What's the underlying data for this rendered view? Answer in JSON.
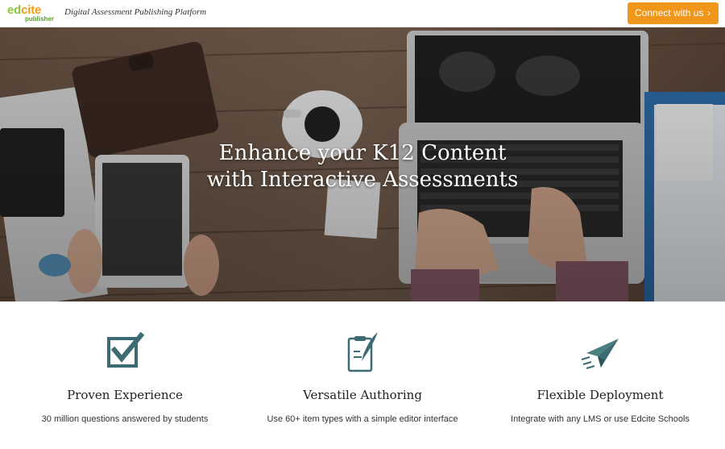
{
  "header": {
    "logo_main_ed": "ed",
    "logo_main_cite": "cite",
    "logo_sub": "publisher",
    "tagline": "Digital Assessment Publishing Platform",
    "connect_label": "Connect with us",
    "connect_icon": "chevron-right-icon"
  },
  "hero": {
    "title_line1": "Enhance your K12 Content",
    "title_line2": "with Interactive Assessments"
  },
  "features": [
    {
      "title": "Proven Experience",
      "description": "30 million questions answered by students",
      "icon": "checkbox-icon"
    },
    {
      "title": "Versatile Authoring",
      "description": "Use 60+ item types with a simple editor interface",
      "icon": "clipboard-quill-icon"
    },
    {
      "title": "Flexible Deployment",
      "description": "Integrate with any LMS or use Edcite Schools",
      "icon": "paper-plane-icon"
    }
  ],
  "colors": {
    "accent_orange": "#f0961b",
    "icon_teal": "#3d6b73",
    "logo_green": "#8cc63f"
  }
}
